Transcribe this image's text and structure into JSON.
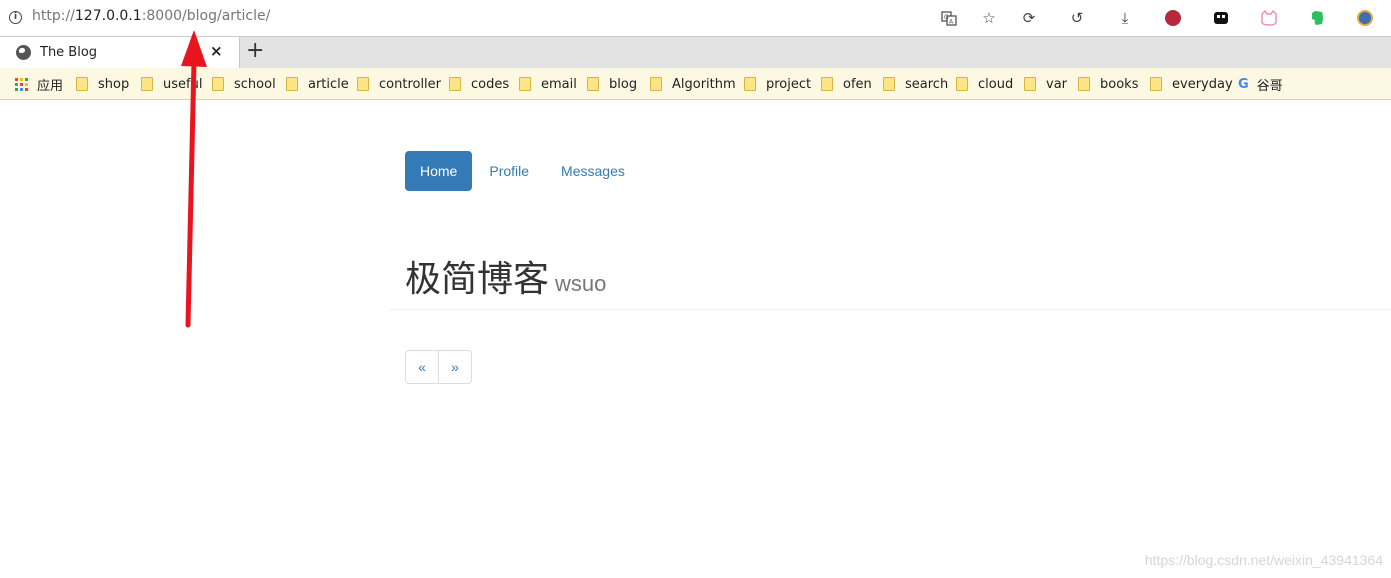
{
  "browser": {
    "url_scheme": "http://",
    "url_host": "127.0.0.1",
    "url_rest": ":8000/blog/article/",
    "tab_title": "The Blog",
    "tab_close": "×",
    "new_tab": "+",
    "toolbar_icons": [
      "translate-icon",
      "star-icon",
      "sync-icon",
      "history-icon",
      "download-icon",
      "avatar-icon",
      "extension-icon",
      "cat-icon",
      "evernote-icon",
      "profile-icon"
    ]
  },
  "bookmarks": [
    {
      "label": "应用",
      "icon": "apps-icon"
    },
    {
      "label": "shop",
      "icon": "folder-icon"
    },
    {
      "label": "useful",
      "icon": "folder-icon"
    },
    {
      "label": "school",
      "icon": "folder-icon"
    },
    {
      "label": "article",
      "icon": "folder-icon"
    },
    {
      "label": "controller",
      "icon": "folder-icon"
    },
    {
      "label": "codes",
      "icon": "folder-icon"
    },
    {
      "label": "email",
      "icon": "folder-icon"
    },
    {
      "label": "blog",
      "icon": "folder-icon"
    },
    {
      "label": "Algorithm",
      "icon": "folder-icon"
    },
    {
      "label": "project",
      "icon": "folder-icon"
    },
    {
      "label": "ofen",
      "icon": "folder-icon"
    },
    {
      "label": "search",
      "icon": "folder-icon"
    },
    {
      "label": "cloud",
      "icon": "folder-icon"
    },
    {
      "label": "var",
      "icon": "folder-icon"
    },
    {
      "label": "books",
      "icon": "folder-icon"
    },
    {
      "label": "everyday",
      "icon": "folder-icon"
    },
    {
      "label": "谷哥",
      "icon": "google-icon"
    }
  ],
  "page": {
    "nav": [
      {
        "label": "Home",
        "active": true
      },
      {
        "label": "Profile",
        "active": false
      },
      {
        "label": "Messages",
        "active": false
      }
    ],
    "title": "极简博客",
    "subtitle": "wsuo",
    "pager": {
      "prev": "«",
      "next": "»"
    }
  },
  "watermark": "https://blog.csdn.net/weixin_43941364",
  "colors": {
    "primary": "#337ab7",
    "bookmark_bar": "#fdf8e2",
    "annotation_arrow": "#e8141e"
  }
}
